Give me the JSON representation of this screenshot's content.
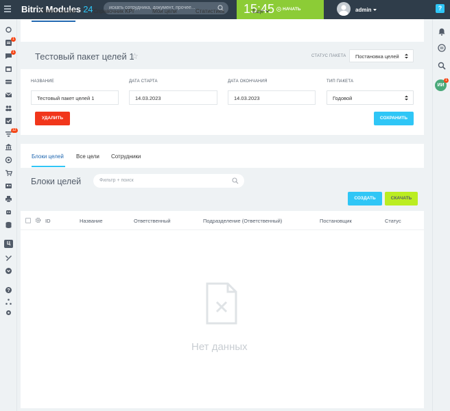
{
  "header": {
    "logo_main": "Bitrix Modules",
    "logo_num": "24",
    "search_placeholder": "искать сотрудника, документ, прочее...",
    "time": "15:45",
    "start_label": "НАЧАТЬ",
    "username": "admin",
    "help_label": "?"
  },
  "leftbar": {
    "badge_1": "1",
    "badge_2": "1",
    "badge_3": "12",
    "letter_item": "Ц"
  },
  "rightbar": {
    "avatar_initials": "ИИ",
    "avatar_badge": "1"
  },
  "main_tabs": [
    "Пакеты целей",
    "Справочник KPI",
    "Мои цели",
    "Статистика",
    "Еще"
  ],
  "page": {
    "title": "Тестовый пакет целей 1",
    "star": "☆",
    "status_label": "СТАТУС ПАКЕТА",
    "status_value": "Постановка целей"
  },
  "form": {
    "name_label": "НАЗВАНИЕ",
    "name_value": "Тестовый пакет целей 1",
    "start_label": "ДАТА СТАРТА",
    "start_value": "14.03.2023",
    "end_label": "ДАТА ОКОНЧАНИЯ",
    "end_value": "14.03.2023",
    "type_label": "ТИП ПАКЕТА",
    "type_value": "Годовой",
    "delete_label": "УДАЛИТЬ",
    "save_label": "СОХРАНИТЬ"
  },
  "sub_tabs": [
    "Блоки целей",
    "Все цели",
    "Сотрудники"
  ],
  "blocks": {
    "title": "Блоки целей",
    "filter_placeholder": "Фильтр + поиск",
    "create_label": "СОЗДАТЬ",
    "download_label": "СКАЧАТЬ"
  },
  "table": {
    "columns": [
      "ID",
      "Название",
      "Ответственный",
      "Подразделение (Ответственный)",
      "Постановщик",
      "Статус"
    ],
    "empty_text": "Нет данных"
  },
  "colors": {
    "header_bg": "#2f3d4a",
    "accent_blue": "#2fc6f6",
    "clock_green": "#8ccc36",
    "delete_red": "#f1361b",
    "download_lime": "#bbed21"
  }
}
